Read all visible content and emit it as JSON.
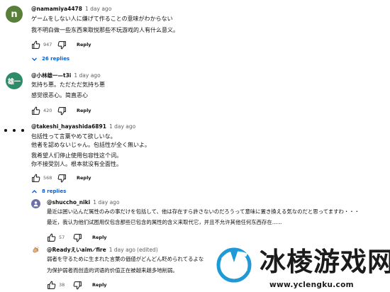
{
  "comments": [
    {
      "avatar_letter": "n",
      "avatar_color": "#5a7f3a",
      "author": "@namamiya4478",
      "time": "1 day ago",
      "lines": [
        "ゲームをしない人に嫌げて作ることの意味がわからない",
        "我不明白做一些东西来取悦那些不玩游戏的人有什么意义。"
      ],
      "likes": "947",
      "reply_label": "Reply",
      "replies_toggle": "26 replies"
    },
    {
      "avatar_letter": "雄一",
      "avatar_color": "#2e8b68",
      "author": "@小林雄一—t3i",
      "time": "1 day ago",
      "lines": [
        "気持ち悪。ただただ気持ち悪",
        "感觉很恶心。简直恶心"
      ],
      "likes": "420",
      "reply_label": "Reply"
    },
    {
      "author": "@takeshi_hayashida6891",
      "time": "1 day ago",
      "lines": [
        "包括性って言葉やめて欲しいな。",
        "他者を認めないじゃん。包括性が全く無いよ。",
        "我希望人们停止使用包容性这个词。",
        "你不接受别人。根本就没有全面性。"
      ],
      "likes": "568",
      "reply_label": "Reply",
      "replies_toggle": "8 replies"
    }
  ],
  "replies": [
    {
      "author": "@shuccho_niki",
      "time": "1 day ago",
      "lines": [
        "最近は囲い込んだ属性のみの事だけを包括して、他は存在すら許さないのだろうって意味に置き換える気なのだと思ってますわ・・・",
        "最近，我认为他们试图用仅包含那些已包含的属性的含义来取代它，并且不允许其他任何东西存在......"
      ],
      "likes": "57",
      "reply_label": "Reply"
    },
    {
      "author": "@Readyえいaim⟋fire",
      "time": "1 day ago",
      "edited": "(edited)",
      "lines": [
        "弱者を守るために生まれた言葉の価値がどんどん貶められてるよな",
        "为保护弱者而创造的词语的价值正在被越来越多地削弱。"
      ],
      "likes": "38",
      "reply_label": "Reply"
    }
  ],
  "watermark": {
    "title": "冰棱游戏网",
    "url": "www.yclengku.com",
    "color": "#1f9ad6"
  }
}
